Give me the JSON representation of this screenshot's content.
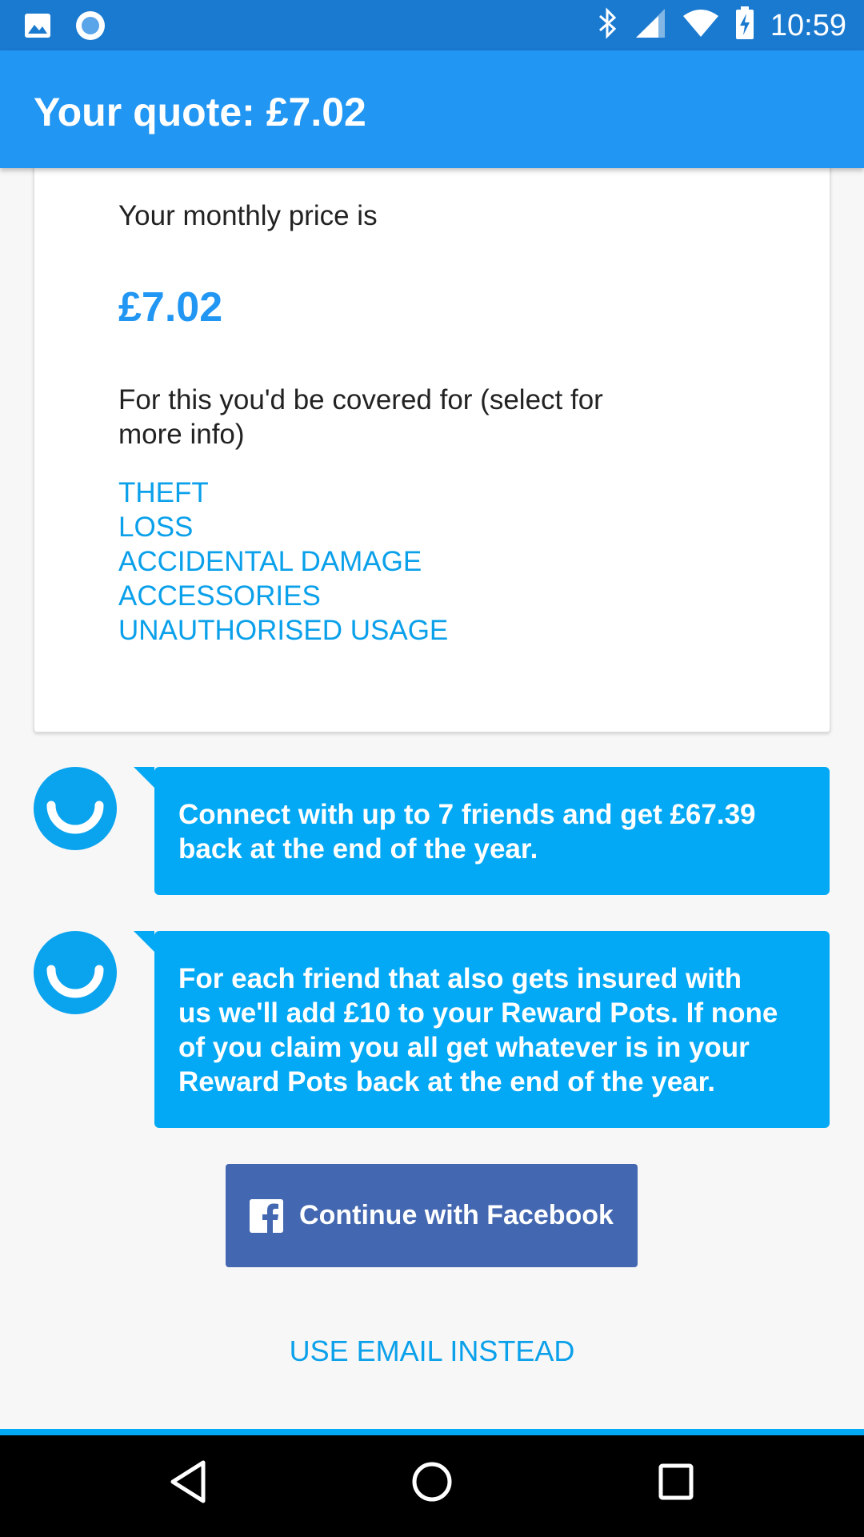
{
  "status_bar": {
    "time": "10:59",
    "icons": [
      "image-icon",
      "circle-app-icon",
      "bluetooth-icon",
      "signal-icon",
      "wifi-icon",
      "battery-icon"
    ]
  },
  "app_bar": {
    "title": "Your quote: £7.02"
  },
  "quote": {
    "monthly_label": "Your monthly price is",
    "price": "£7.02",
    "covered_text": "For this you'd be covered for (select for more info)",
    "cover_items": [
      "THEFT",
      "LOSS",
      "ACCIDENTAL DAMAGE",
      "ACCESSORIES",
      "UNAUTHORISED USAGE"
    ]
  },
  "messages": [
    "Connect with up to 7 friends and get £67.39 back at the end of the year.",
    "For each friend that also gets insured with us we'll add £10 to your Reward Pots. If none of you claim you all get whatever is in your Reward Pots back at the end of the year."
  ],
  "buttons": {
    "facebook": "Continue with Facebook",
    "email": "USE EMAIL INSTEAD"
  },
  "colors": {
    "status_bar": "#1a7ad0",
    "app_bar": "#2196f3",
    "accent": "#03a9f4",
    "facebook": "#4367b0"
  },
  "nav_bar": {
    "icons": [
      "back-icon",
      "home-icon",
      "recents-icon"
    ]
  }
}
